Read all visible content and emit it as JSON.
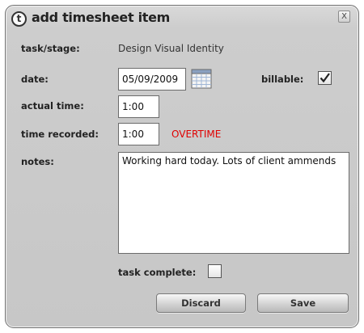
{
  "dialog": {
    "logo_letter": "t",
    "title": "add timesheet item",
    "close_label": "X"
  },
  "form": {
    "task_label": "task/stage:",
    "task_value": "Design Visual Identity",
    "date_label": "date:",
    "date_value": "05/09/2009",
    "billable_label": "billable:",
    "billable_checked": true,
    "actual_time_label": "actual time:",
    "actual_time_value": "1:00",
    "time_recorded_label": "time recorded:",
    "time_recorded_value": "1:00",
    "overtime_text": "OVERTIME",
    "notes_label": "notes:",
    "notes_value": "Working hard today. Lots of client ammends",
    "task_complete_label": "task complete:",
    "task_complete_checked": false
  },
  "buttons": {
    "discard_label": "Discard",
    "save_label": "Save"
  },
  "colors": {
    "overtime": "#e00000",
    "dialog_background": "#cdcdcd"
  },
  "icons": {
    "title_logo": "t-circle-logo",
    "calendar": "calendar-icon",
    "close": "close-icon"
  }
}
